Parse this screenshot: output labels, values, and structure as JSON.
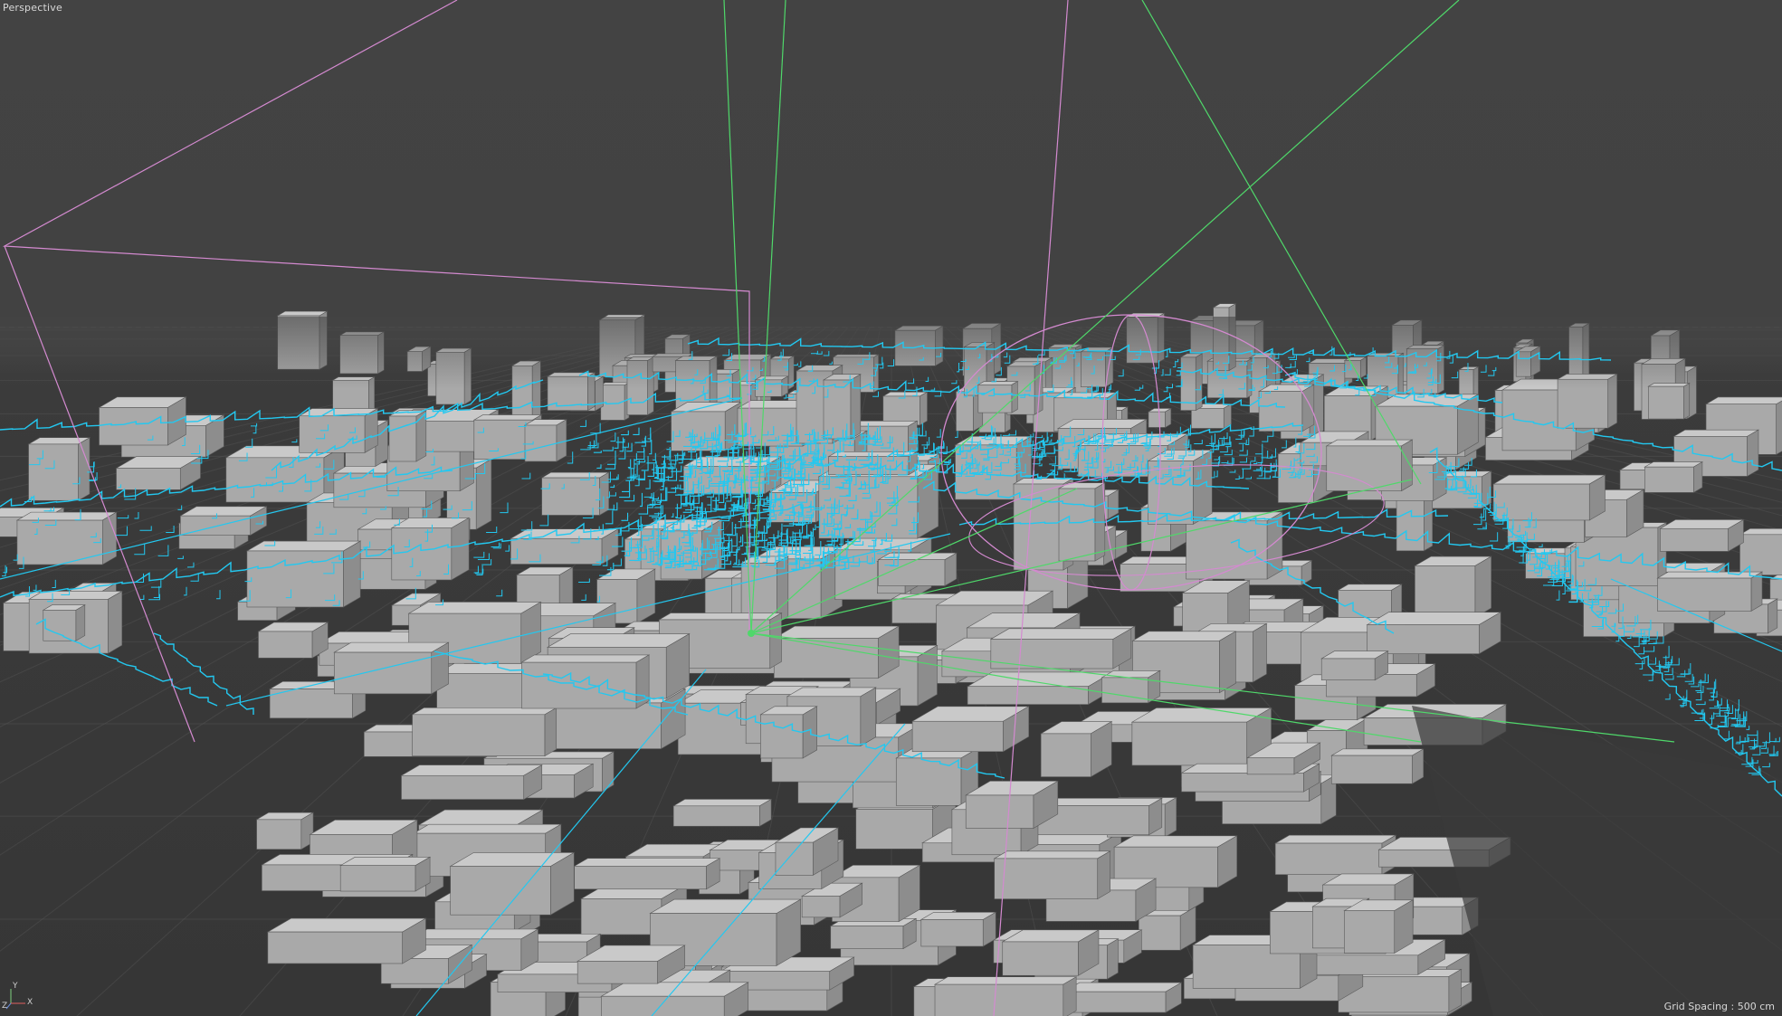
{
  "viewport": {
    "view_name": "Perspective",
    "grid_spacing_label": "Grid Spacing :",
    "grid_spacing_value": "500 cm"
  },
  "axes": {
    "y": "Y",
    "x": "X",
    "z": "Z"
  },
  "colors": {
    "background": "#3a3a3a",
    "spline": "#23c8f0",
    "light_gizmo": "#d48ad0",
    "camera_gizmo": "#4fd86a",
    "buildings": "#b4b4b4",
    "grid": "#525252"
  },
  "icons": [
    "axis-gizmo-icon"
  ]
}
